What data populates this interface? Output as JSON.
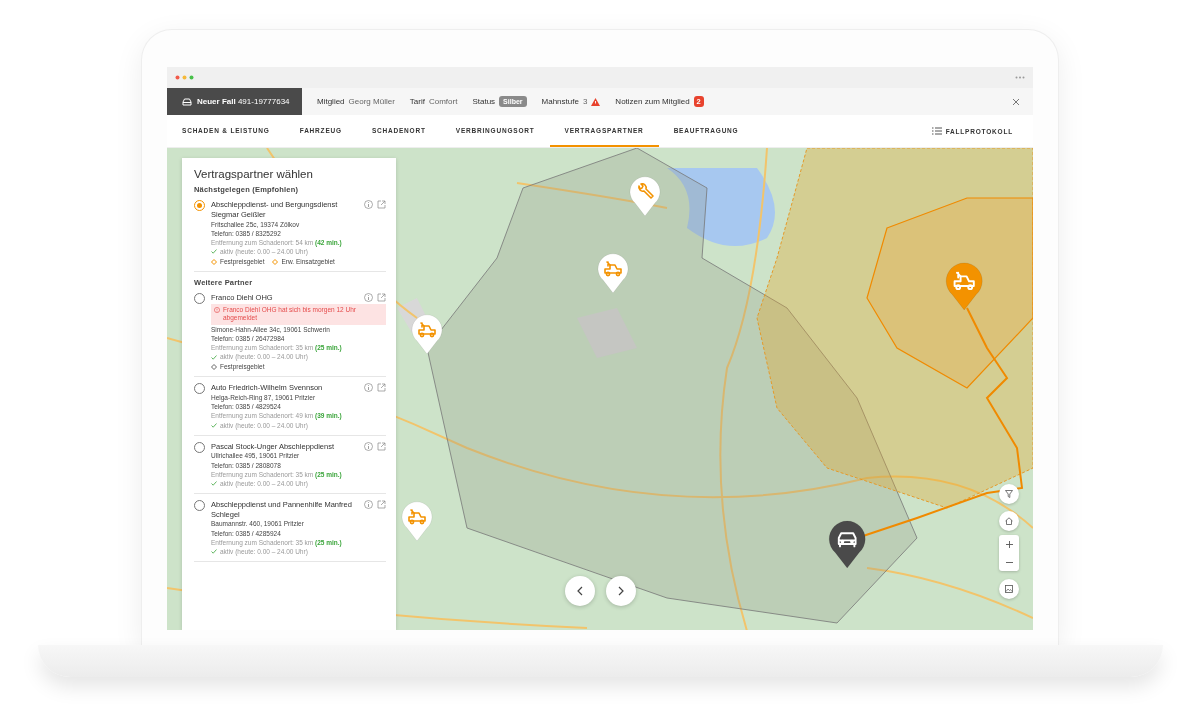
{
  "case": {
    "label": "Neuer Fall",
    "number": "491-19777634"
  },
  "header_items": [
    {
      "kind": "text",
      "label": "Mitglied",
      "value": "Georg Müller"
    },
    {
      "kind": "text",
      "label": "Tarif",
      "value": "Comfort"
    },
    {
      "kind": "badge",
      "label": "Status",
      "value": "Silber"
    },
    {
      "kind": "warning",
      "label": "Mahnstufe",
      "value": "3"
    },
    {
      "kind": "count",
      "label": "Notizen zum Mitglied",
      "value": "2"
    }
  ],
  "tabs": [
    {
      "label": "SCHADEN & LEISTUNG",
      "selected": false
    },
    {
      "label": "FAHRZEUG",
      "selected": false
    },
    {
      "label": "SCHADENORT",
      "selected": false
    },
    {
      "label": "VERBRINGUNGSORT",
      "selected": false
    },
    {
      "label": "VERTRAGSPARTNER",
      "selected": true
    },
    {
      "label": "BEAUFTRAGUNG",
      "selected": false
    }
  ],
  "log_button": "FALLPROTOKOLL",
  "panel": {
    "title": "Vertragspartner wählen",
    "sections": [
      {
        "heading": "Nächstgelegen (Empfohlen)",
        "partners": [
          {
            "name": "Abschleppdienst- und Bergungsdienst Siegmar Geißler",
            "selected": true,
            "address": "Fritschallee 25c, 19374 Zölkov",
            "phone": "Telefon: 0385 / 8325292",
            "distance": "Entfernung zum Schadenort: 54 km **(42 min.)**",
            "availability": "aktiv (heute: 0.00 – 24.00 Uhr)",
            "areas": [
              {
                "label": "Festpreisgebiet",
                "highlighted": true
              },
              {
                "label": "Erw. Einsatzgebiet",
                "highlighted": true
              }
            ]
          }
        ]
      },
      {
        "heading": "Weitere Partner",
        "partners": [
          {
            "name": "Franco Diehl OHG",
            "selected": false,
            "warning": "Franco Diehl OHG hat sich bis morgen 12 Uhr abgemeldet",
            "address": "Simone-Hahn-Allee 34c, 19061 Schwerin",
            "phone": "Telefon: 0385 / 26472984",
            "distance": "Entfernung zum Schadenort: 35 km **(25 min.)**",
            "availability": "aktiv (heute: 0.00 – 24.00 Uhr)",
            "areas": [
              {
                "label": "Festpreisgebiet",
                "highlighted": false
              }
            ]
          },
          {
            "name": "Auto Friedrich-Wilhelm Svennson",
            "selected": false,
            "address": "Helga-Reich-Ring 87, 19061 Pritzier",
            "phone": "Telefon: 0385 / 4829524",
            "distance": "Entfernung zum Schadenort: 49 km **(39 min.)**",
            "availability": "aktiv (heute: 0.00 – 24.00 Uhr)"
          },
          {
            "name": "Pascal Stock-Unger Abschleppdienst",
            "selected": false,
            "address": "Ullrichallee 495, 19061 Pritzier",
            "phone": "Telefon: 0385 / 2808078",
            "distance": "Entfernung zum Schadenort: 35 km **(25 min.)**",
            "availability": "aktiv (heute: 0.00 – 24.00 Uhr)"
          },
          {
            "name": "Abschleppdienst und Pannenhilfe Manfred Schlegel",
            "selected": false,
            "address": "Baumannstr. 460, 19061 Pritzier",
            "phone": "Telefon: 0385 / 4285924",
            "distance": "Entfernung zum Schadenort: 35 km **(25 min.)**",
            "availability": "aktiv (heute: 0.00 – 24.00 Uhr)"
          }
        ]
      }
    ]
  }
}
